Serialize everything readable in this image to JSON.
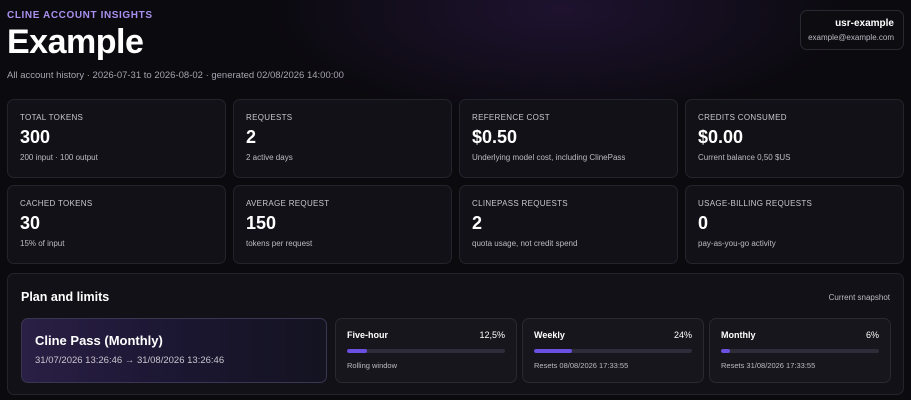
{
  "header": {
    "brand": "CLINE ACCOUNT INSIGHTS",
    "title": "Example",
    "subtitle": "All account history · 2026-07-31 to 2026-08-02 · generated 02/08/2026 14:00:00"
  },
  "user": {
    "id": "usr-example",
    "email": "example@example.com"
  },
  "metrics": [
    {
      "label": "TOTAL TOKENS",
      "value": "300",
      "sub": "200 input · 100 output"
    },
    {
      "label": "REQUESTS",
      "value": "2",
      "sub": "2 active days"
    },
    {
      "label": "REFERENCE COST",
      "value": "$0.50",
      "sub": "Underlying model cost, including ClinePass"
    },
    {
      "label": "CREDITS CONSUMED",
      "value": "$0.00",
      "sub": "Current balance 0,50 $US"
    },
    {
      "label": "CACHED TOKENS",
      "value": "30",
      "sub": "15% of input"
    },
    {
      "label": "AVERAGE REQUEST",
      "value": "150",
      "sub": "tokens per request"
    },
    {
      "label": "CLINEPASS REQUESTS",
      "value": "2",
      "sub": "quota usage, not credit spend"
    },
    {
      "label": "USAGE-BILLING REQUESTS",
      "value": "0",
      "sub": "pay-as-you-go activity"
    }
  ],
  "plan": {
    "title": "Plan and limits",
    "snapshot": "Current snapshot",
    "name": "Cline Pass (Monthly)",
    "period": "31/07/2026 13:26:46 → 31/08/2026 13:26:46",
    "accent": "#6a4fe0",
    "limits": [
      {
        "name": "Five-hour",
        "percent": "12,5%",
        "fraction": 0.125,
        "note": "Rolling window"
      },
      {
        "name": "Weekly",
        "percent": "24%",
        "fraction": 0.24,
        "note": "Resets 08/08/2026 17:33:55"
      },
      {
        "name": "Monthly",
        "percent": "6%",
        "fraction": 0.06,
        "note": "Resets 31/08/2026 17:33:55"
      }
    ]
  }
}
